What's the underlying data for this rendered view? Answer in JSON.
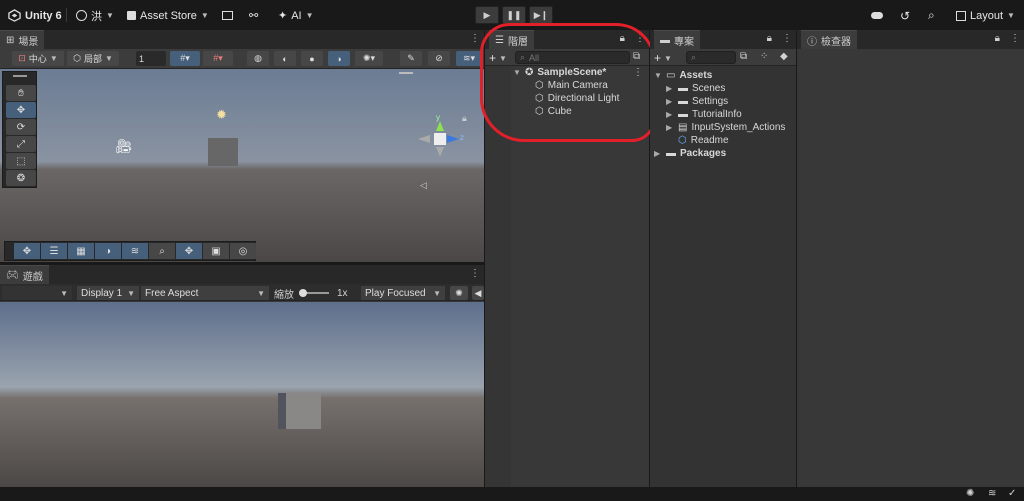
{
  "toolbar": {
    "app_name": "Unity 6",
    "account_label": "洪",
    "asset_store_label": "Asset Store",
    "ai_label": "AI",
    "layout_label": "Layout",
    "colors": {
      "background": "#191919",
      "accent": "#46607c"
    }
  },
  "scene": {
    "tab_label": "場景",
    "pivot_label": "中心",
    "space_label": "局部",
    "grid_value": "1",
    "gizmo_axes": {
      "y": "y",
      "z": "z"
    }
  },
  "game": {
    "tab_label": "遊戲",
    "display_label": "Display 1",
    "aspect_label": "Free Aspect",
    "scale_label": "縮放",
    "scale_value": "1x",
    "play_mode_label": "Play Focused"
  },
  "hierarchy": {
    "tab_label": "階層",
    "search_placeholder": "All",
    "scene_name": "SampleScene*",
    "items": [
      "Main Camera",
      "Directional Light",
      "Cube"
    ]
  },
  "project": {
    "tab_label": "專案",
    "tree": [
      {
        "label": "Assets",
        "level": 0,
        "expanded": true
      },
      {
        "label": "Scenes",
        "level": 1
      },
      {
        "label": "Settings",
        "level": 1
      },
      {
        "label": "TutorialInfo",
        "level": 1
      },
      {
        "label": "InputSystem_Actions",
        "level": 1
      },
      {
        "label": "Readme",
        "level": 1
      },
      {
        "label": "Packages",
        "level": 0
      }
    ]
  },
  "inspector": {
    "tab_label": "檢查器"
  }
}
